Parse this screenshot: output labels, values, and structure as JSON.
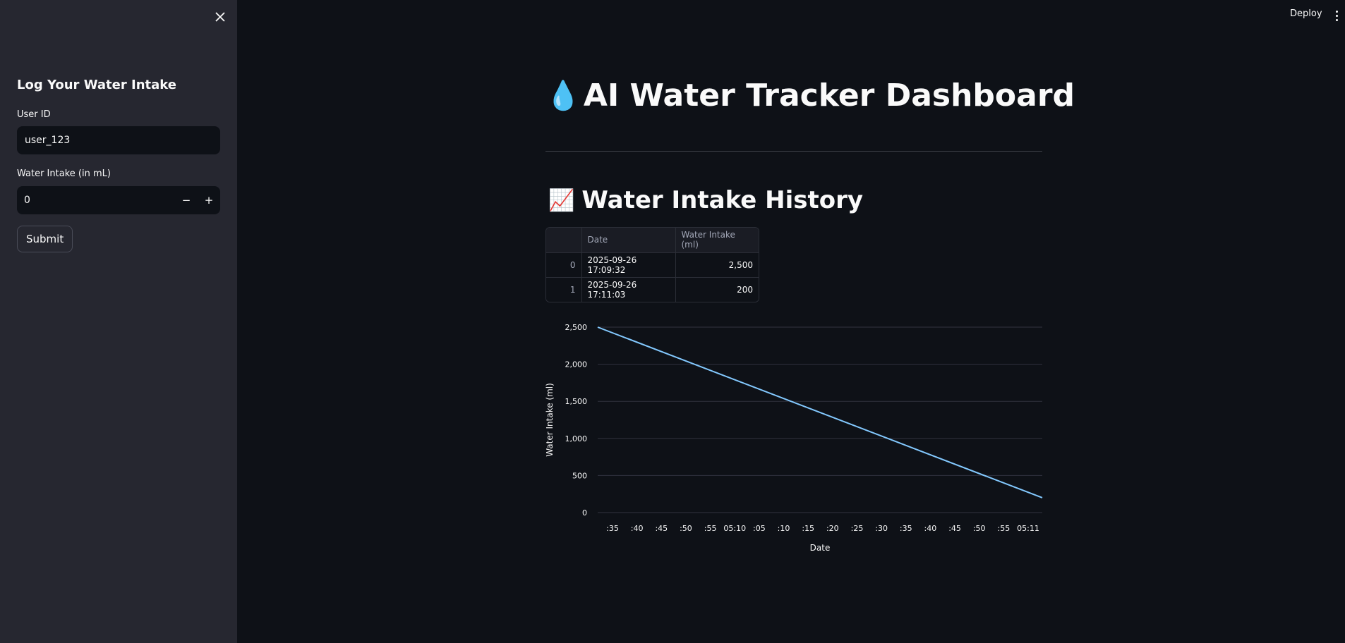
{
  "sidebar": {
    "title": "Log Your Water Intake",
    "user_id_label": "User ID",
    "user_id_value": "user_123",
    "intake_label": "Water Intake (in mL)",
    "intake_value": "0",
    "minus_label": "−",
    "plus_label": "+",
    "submit_label": "Submit"
  },
  "header": {
    "deploy_label": "Deploy"
  },
  "main": {
    "title_icon": "💧",
    "title": "AI Water Tracker Dashboard",
    "section_icon": "📈",
    "section_title": "Water Intake History",
    "table": {
      "columns": [
        "",
        "Date",
        "Water Intake (ml)"
      ],
      "rows": [
        {
          "index": "0",
          "date": "2025-09-26 17:09:32",
          "intake": "2,500"
        },
        {
          "index": "1",
          "date": "2025-09-26 17:11:03",
          "intake": "200"
        }
      ]
    }
  },
  "chart_data": {
    "type": "line",
    "x": [
      "2025-09-26 17:09:32",
      "2025-09-26 17:11:03"
    ],
    "series": [
      {
        "values": [
          2500,
          200
        ],
        "color": "#83c9ff"
      }
    ],
    "xlabel": "Date",
    "ylabel": "Water Intake (ml)",
    "ylim": [
      0,
      2500
    ],
    "yticks": [
      "0",
      "500",
      "1,000",
      "1,500",
      "2,000",
      "2,500"
    ],
    "xticks": [
      ":35",
      ":40",
      ":45",
      ":50",
      ":55",
      "05:10",
      ":05",
      ":10",
      ":15",
      ":20",
      ":25",
      ":30",
      ":35",
      ":40",
      ":45",
      ":50",
      ":55",
      "05:11"
    ],
    "grid": true
  }
}
